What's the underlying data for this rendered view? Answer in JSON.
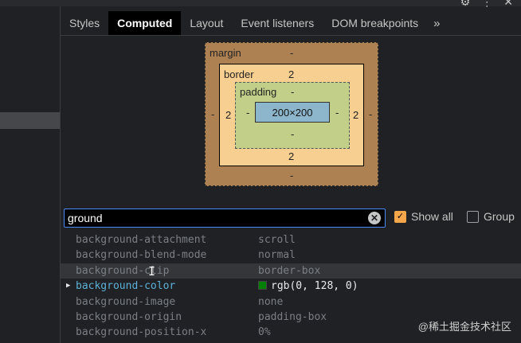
{
  "tabs": [
    {
      "label": "Styles"
    },
    {
      "label": "Computed"
    },
    {
      "label": "Layout"
    },
    {
      "label": "Event listeners"
    },
    {
      "label": "DOM breakpoints"
    },
    {
      "label": "»"
    }
  ],
  "box_model": {
    "margin_label": "margin",
    "margin_top": "-",
    "margin_left": "-",
    "margin_right": "-",
    "margin_bottom": "-",
    "border_label": "border",
    "border_top": "2",
    "border_left": "2",
    "border_right": "2",
    "border_bottom": "2",
    "padding_label": "padding",
    "padding_top": "-",
    "padding_left": "-",
    "padding_right": "-",
    "padding_bottom": "-",
    "content": "200×200"
  },
  "filter": {
    "value": "ground"
  },
  "show_all": {
    "label": "Show all",
    "checked": true
  },
  "group": {
    "label": "Group",
    "checked": false
  },
  "properties": [
    {
      "name": "background-attachment",
      "value": "scroll"
    },
    {
      "name": "background-blend-mode",
      "value": "normal"
    },
    {
      "name": "background-clip",
      "value": "border-box"
    },
    {
      "name": "background-color",
      "value": "rgb(0, 128, 0)",
      "swatch": "#008000"
    },
    {
      "name": "background-image",
      "value": "none"
    },
    {
      "name": "background-origin",
      "value": "padding-box"
    },
    {
      "name": "background-position-x",
      "value": "0%"
    }
  ],
  "watermark": "@稀土掘金技术社区"
}
